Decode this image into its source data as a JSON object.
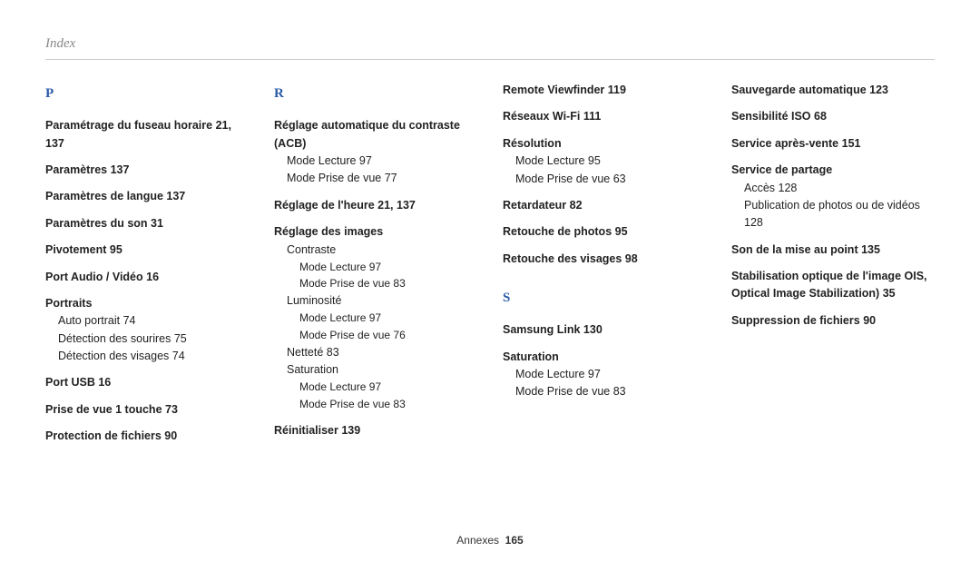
{
  "header": {
    "section": "Index"
  },
  "footer": {
    "label": "Annexes",
    "page": "165"
  },
  "col1": {
    "letter": "P",
    "e1_title": "Paramétrage du fuseau horaire",
    "e1_pages": "21,  137",
    "e2_title": "Paramètres",
    "e2_pages": "137",
    "e3_title": "Paramètres de langue",
    "e3_pages": "137",
    "e4_title": "Paramètres du son",
    "e4_pages": "31",
    "e5_title": "Pivotement",
    "e5_pages": "95",
    "e6_title": "Port Audio / Vidéo",
    "e6_pages": "16",
    "e7_title": "Portraits",
    "e7_s1": "Auto portrait  74",
    "e7_s2": "Détection des sourires  75",
    "e7_s3": "Détection des visages  74",
    "e8_title": "Port USB",
    "e8_pages": "16",
    "e9_title": "Prise de vue 1 touche",
    "e9_pages": "73",
    "e10_title": "Protection de fichiers",
    "e10_pages": "90"
  },
  "col2": {
    "letter": "R",
    "e1_title": "Réglage automatique du contraste (ACB)",
    "e1_s1": "Mode Lecture  97",
    "e1_s2": "Mode Prise de vue  77",
    "e2_title": "Réglage de l'heure",
    "e2_pages": "21,  137",
    "e3_title": "Réglage des images",
    "e3_s1": "Contraste",
    "e3_s1a": "Mode Lecture  97",
    "e3_s1b": "Mode Prise de vue  83",
    "e3_s2": "Luminosité",
    "e3_s2a": "Mode Lecture  97",
    "e3_s2b": "Mode Prise de vue  76",
    "e3_s3": "Netteté  83",
    "e3_s4": "Saturation",
    "e3_s4a": "Mode Lecture  97",
    "e3_s4b": "Mode Prise de vue  83",
    "e4_title": "Réinitialiser",
    "e4_pages": "139"
  },
  "col3": {
    "e1_title": "Remote Viewfinder",
    "e1_pages": "119",
    "e2_title": "Réseaux Wi-Fi",
    "e2_pages": "111",
    "e3_title": "Résolution",
    "e3_s1": "Mode Lecture  95",
    "e3_s2": "Mode Prise de vue  63",
    "e4_title": "Retardateur",
    "e4_pages": "82",
    "e5_title": "Retouche de photos",
    "e5_pages": "95",
    "e6_title": "Retouche des visages",
    "e6_pages": "98",
    "letter": "S",
    "e7_title": "Samsung Link",
    "e7_pages": "130",
    "e8_title": "Saturation",
    "e8_s1": "Mode Lecture  97",
    "e8_s2": "Mode Prise de vue  83"
  },
  "col4": {
    "e1_title": "Sauvegarde automatique",
    "e1_pages": "123",
    "e2_title": "Sensibilité ISO",
    "e2_pages": "68",
    "e3_title": "Service après-vente",
    "e3_pages": "151",
    "e4_title": "Service de partage",
    "e4_s1": "Accès  128",
    "e4_s2": "Publication de photos ou de vidéos  128",
    "e5_title": "Son de la mise au point",
    "e5_pages": "135",
    "e6_title": "Stabilisation optique de l'image OIS, Optical Image Stabilization)",
    "e6_pages": "35",
    "e7_title": "Suppression de fichiers",
    "e7_pages": "90"
  }
}
